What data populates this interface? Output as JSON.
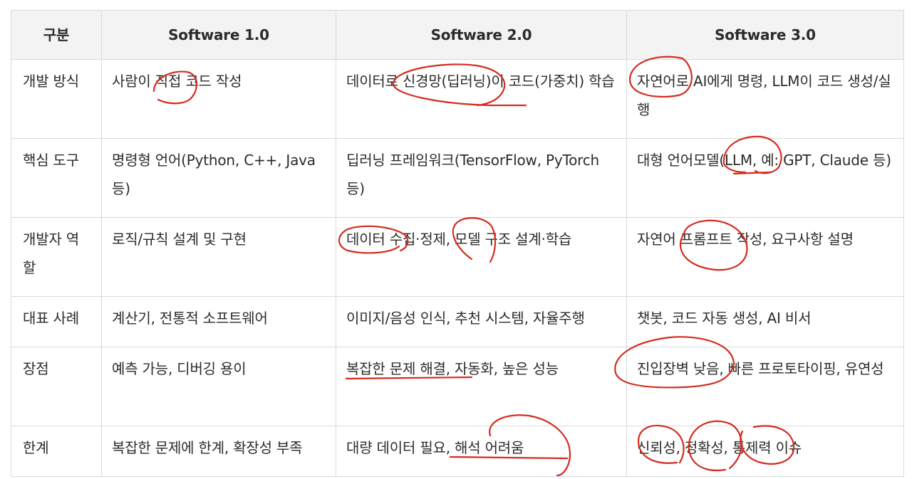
{
  "header": {
    "category": "구분",
    "v1": "Software 1.0",
    "v2": "Software 2.0",
    "v3": "Software 3.0"
  },
  "rows": [
    {
      "label": "개발 방식",
      "v1": "사람이 직접 코드 작성",
      "v2": "데이터로 신경망(딥러닝)이 코드(가중치) 학습",
      "v3": "자연어로 AI에게 명령, LLM이 코드 생성/실행"
    },
    {
      "label": "핵심 도구",
      "v1": "명령형 언어(Python, C++, Java 등)",
      "v2": "딥러닝 프레임워크(TensorFlow, PyTorch 등)",
      "v3": "대형 언어모델(LLM, 예: GPT, Claude 등)"
    },
    {
      "label": "개발자 역할",
      "v1": "로직/규칙 설계 및 구현",
      "v2": "데이터 수집·정제, 모델 구조 설계·학습",
      "v3": "자연어 프롬프트 작성, 요구사항 설명"
    },
    {
      "label": "대표 사례",
      "v1": "계산기, 전통적 소프트웨어",
      "v2": "이미지/음성 인식, 추천 시스템, 자율주행",
      "v3": "챗봇, 코드 자동 생성, AI 비서"
    },
    {
      "label": "장점",
      "v1": "예측 가능, 디버깅 용이",
      "v2": "복잡한 문제 해결, 자동화, 높은 성능",
      "v3": "진입장벽 낮음, 빠른 프로토타이핑, 유연성"
    },
    {
      "label": "한계",
      "v1": "복잡한 문제에 한계, 확장성 부족",
      "v2": "대량 데이터 필요, 해석 어려움",
      "v3": "신뢰성, 정확성, 통제력 이슈"
    }
  ],
  "annotation_color": "#d42b1e"
}
